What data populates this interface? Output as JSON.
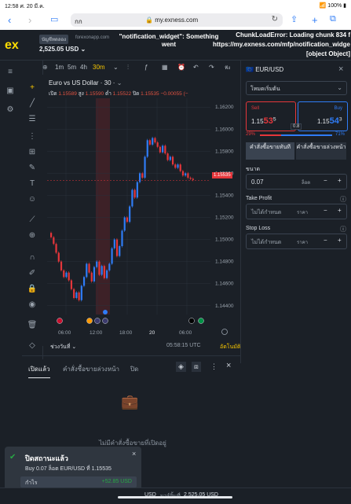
{
  "status": {
    "time": "12:58",
    "date": "ศ. 20 มี.ค.",
    "battery": "100%"
  },
  "safari": {
    "aa": "กก",
    "url": "my.exness.com"
  },
  "header": {
    "logo": "ex",
    "account_type": "บัญชีทดลอง",
    "domain": "forexonapp.com",
    "balance": "2,525.05 USD",
    "error_widget": "\"notification_widget\": Something went",
    "error_chunk_1": "ChunkLoadError: Loading chunk 834 f",
    "error_chunk_2": "https://my.exness.com/mfp/notification_widge",
    "error_chunk_3": "[object Object]"
  },
  "chart_toolbar": {
    "tf_1m": "1m",
    "tf_5m": "5m",
    "tf_4h": "4h",
    "tf_30m": "30m",
    "indicator_label": "ฟัง"
  },
  "chart": {
    "title": "Euro vs US Dollar · 30 ·",
    "ohlc_open_label": "เปิด",
    "ohlc_open": "1.15589",
    "ohlc_high_label": "สูง",
    "ohlc_high": "1.15590",
    "ohlc_low_label": "ต่ำ",
    "ohlc_low": "1.15522",
    "ohlc_close_label": "ปิด",
    "ohlc_close": "1.15535",
    "ohlc_change": "−0.00055 (−",
    "price_tag": "1.15535",
    "period_label": "ช่วงวันที่",
    "clock": "05:58:15 UTC",
    "auto_label": "อัตโนมัติ"
  },
  "chart_data": {
    "type": "candlestick",
    "x_ticks": [
      "06:00",
      "12:00",
      "18:00",
      "20",
      "06:00"
    ],
    "y_ticks": [
      "1.16200",
      "1.16000",
      "1.15800",
      "1.15600",
      "1.15400",
      "1.15200",
      "1.15000",
      "1.14800",
      "1.14600",
      "1.14400"
    ],
    "ylim": [
      1.1432,
      1.1628
    ],
    "last_price": 1.15535,
    "closes": [
      1.1502,
      1.1496,
      1.1488,
      1.148,
      1.1472,
      1.1466,
      1.147,
      1.1463,
      1.1455,
      1.1447,
      1.1452,
      1.1445,
      1.1458,
      1.1466,
      1.1478,
      1.147,
      1.1462,
      1.1475,
      1.148,
      1.1468,
      1.1476,
      1.1465,
      1.1472,
      1.1478,
      1.1492,
      1.15,
      1.1485,
      1.1494,
      1.1508,
      1.152,
      1.1516,
      1.153,
      1.1545,
      1.1538,
      1.1552,
      1.156,
      1.1556,
      1.1575,
      1.159,
      1.1586,
      1.1592,
      1.1588,
      1.1584,
      1.1579,
      1.1585,
      1.1578,
      1.1572,
      1.1575,
      1.1568,
      1.1565,
      1.1568,
      1.1562,
      1.1558,
      1.156,
      1.1556,
      1.1555,
      1.1554
    ]
  },
  "right_panel": {
    "symbol": "EUR/USD",
    "mode": "โหมดเริ่มต้น",
    "sell_label": "Sell",
    "sell_price_a": "1.15",
    "sell_price_b": "53",
    "sell_price_c": "5",
    "buy_label": "Buy",
    "buy_price_a": "1.15",
    "buy_price_b": "54",
    "buy_price_c": "3",
    "spread": "0.8",
    "sell_pct": "29%",
    "buy_pct": "71%",
    "sentiment_sell_fraction": 0.29,
    "market_order": "คำสั่งซื้อขายทันที",
    "pending_order": "คำสั่งซื้อขายล่วงหน้า",
    "volume_label": "ขนาด",
    "volume_value": "0.07",
    "volume_unit": "ล็อต",
    "take_profit_label": "Take Profit",
    "take_profit_value": "ไม่ได้กำหนด",
    "take_profit_unit": "ราคา",
    "stop_loss_label": "Stop Loss",
    "stop_loss_value": "ไม่ได้กำหนด",
    "stop_loss_unit": "ราคา",
    "minus": "−",
    "plus": "+"
  },
  "bottom_panel": {
    "tab_open": "เปิดแล้ว",
    "tab_pending": "คำสั่งซื้อขายล่วงหน้า",
    "tab_closed": "ปิด",
    "empty_text": "ไม่มีคำสั่งซื้อขายที่เปิดอยู่"
  },
  "toast": {
    "title": "ปิดสถานะแล้ว",
    "detail": "Buy 0.07 ล็อต EUR/USD ที่ 1.15535",
    "profit_label": "กำไร",
    "profit_value": "+52.85 USD"
  },
  "footer": {
    "usd": "USD",
    "margin_label": "มาร์จิ้นที่",
    "margin_value": "2,525.05 USD"
  }
}
